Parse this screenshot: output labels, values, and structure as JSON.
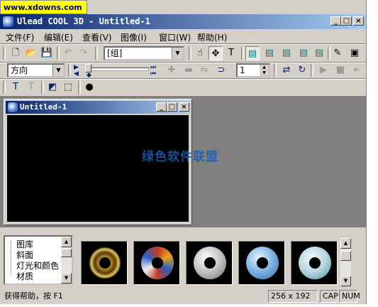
{
  "watermark": "www.xdowns.com",
  "window": {
    "title": "Ulead COOL 3D - Untitled-1"
  },
  "title_buttons": {
    "minimize": "_",
    "maximize": "□",
    "close": "×"
  },
  "menu": [
    "文件(F)",
    "编辑(E)",
    "查看(V)",
    "图像(I)",
    "窗口(W)",
    "帮助(H)"
  ],
  "toolbar1": {
    "object_combo": "[组]"
  },
  "toolbar2": {
    "direction_combo": "方向",
    "frame_value": "1"
  },
  "doc_window": {
    "title": "Untitled-1"
  },
  "overlay_text": "绿色软件联盟",
  "library_tree": [
    "图库",
    "斜面",
    "灯光和颜色",
    "材质"
  ],
  "thumbnails": [
    {
      "name": "gold-torus",
      "color": "#caa02a"
    },
    {
      "name": "stained-glass-torus",
      "color": "#c03a2a"
    },
    {
      "name": "white-marble-torus",
      "color": "#e0e0e0"
    },
    {
      "name": "blue-sky-torus",
      "color": "#7ab0e0"
    },
    {
      "name": "water-torus",
      "color": "#b8d4dc"
    }
  ],
  "status": {
    "help": "获得帮助，按 F1",
    "size": "256 x 192",
    "caps": "CAP",
    "num": "NUM"
  }
}
